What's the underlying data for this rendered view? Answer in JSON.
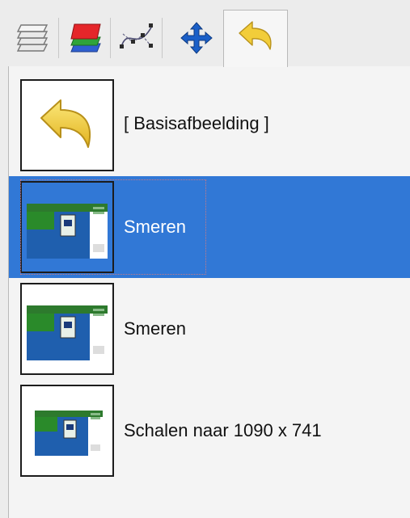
{
  "tabs": [
    {
      "icon": "layers-icon",
      "active": false
    },
    {
      "icon": "channels-icon",
      "active": false
    },
    {
      "icon": "paths-icon",
      "active": false
    },
    {
      "icon": "move-icon",
      "active": false
    },
    {
      "icon": "undo-history-icon",
      "active": true
    }
  ],
  "history": {
    "items": [
      {
        "label": "[ Basisafbeelding ]",
        "thumb": "undo-arrow",
        "selected": false
      },
      {
        "label": "Smeren",
        "thumb": "screenshot",
        "selected": true
      },
      {
        "label": "Smeren",
        "thumb": "screenshot",
        "selected": false
      },
      {
        "label": "Schalen naar 1090 x 741",
        "thumb": "screenshot-small",
        "selected": false
      }
    ]
  },
  "colors": {
    "selection": "#3178d6",
    "undo_arrow": "#f2cd3a",
    "move_arrows": "#1a5fc8"
  }
}
